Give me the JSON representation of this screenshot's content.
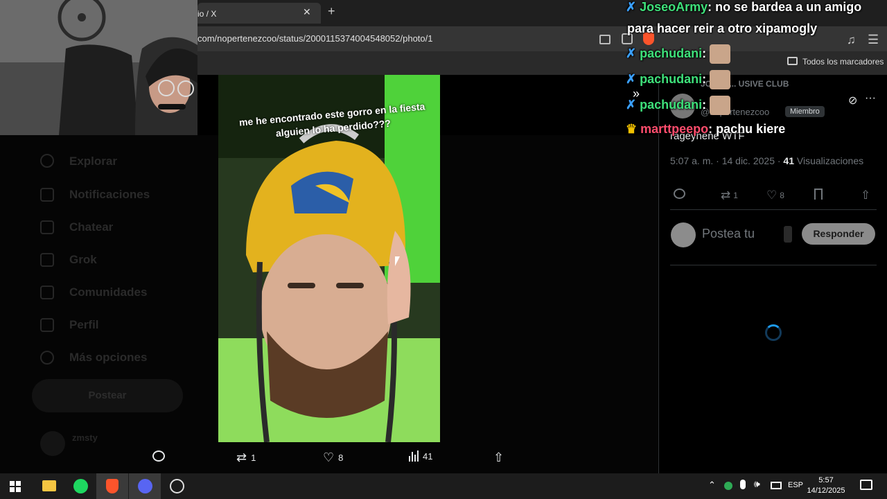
{
  "browser": {
    "tab_title": "io / X",
    "url": "com/nopertenezcoo/status/2000115374004548052/photo/1",
    "bookmarks_label": "Todos los marcadores"
  },
  "x_nav": {
    "items": [
      "Explorar",
      "Notificaciones",
      "Chatear",
      "Grok",
      "Comunidades",
      "Perfil",
      "Más opciones"
    ],
    "post_button": "Postear",
    "account_name": "zmsty"
  },
  "photo": {
    "caption": "me he encontrado este gorro en la fiesta alguien lo ha perdido???"
  },
  "media_actions": {
    "retweets": "1",
    "likes": "8",
    "views": "41"
  },
  "tweet": {
    "community": "JOSEO... USIVE CLUB",
    "handle": "@nopertenezcoo",
    "member_badge": "Miembro",
    "text": "rageyhene WTF",
    "time": "5:07 a. m. · 14 dic. 2025 ·",
    "views_count": "41",
    "views_label": "Visualizaciones",
    "retweets": "1",
    "likes": "8",
    "reply_placeholder": "Postea tu",
    "reply_button": "Responder"
  },
  "chat": [
    {
      "user": "JoseoArmy",
      "message": "no se bardea a un amigo"
    },
    {
      "user": "",
      "message": "para hacer reir a otro xipamogly"
    },
    {
      "user": "pachudani",
      "message": ""
    },
    {
      "user": "pachudani",
      "message": ""
    },
    {
      "user": "pachudani",
      "message": ""
    },
    {
      "user": "marttpeepo",
      "message": "pachu kiere"
    }
  ],
  "taskbar": {
    "language": "ESP",
    "time": "5:57",
    "date": "14/12/2025"
  },
  "colors": {
    "chat_username": "#3ee07a",
    "accent_blue": "#1d9bf0",
    "photo_green": "#3b8f2b",
    "beanie_yellow": "#e3b21e"
  }
}
